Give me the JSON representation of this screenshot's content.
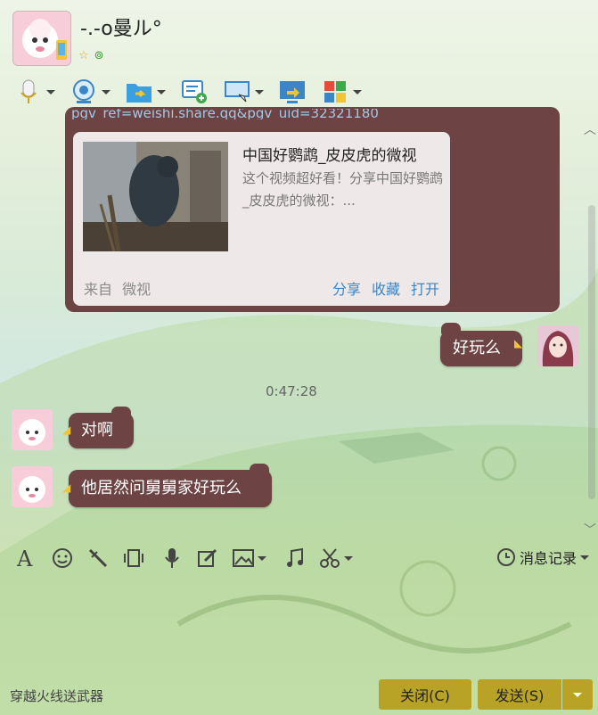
{
  "header": {
    "title": "-.-o曼ル°",
    "status_icons": [
      "star-icon",
      "search-icon"
    ]
  },
  "toolbar": {
    "buttons": [
      {
        "name": "voice-call",
        "icon": "microphone-icon",
        "has_dropdown": true
      },
      {
        "name": "video-call",
        "icon": "webcam-icon",
        "has_dropdown": true
      },
      {
        "name": "send-file",
        "icon": "folder-icon",
        "has_dropdown": true
      },
      {
        "name": "new-discussion",
        "icon": "chat-add-icon",
        "has_dropdown": false
      },
      {
        "name": "remote-desktop",
        "icon": "monitor-icon",
        "has_dropdown": true
      },
      {
        "name": "share-screen",
        "icon": "screen-share-icon",
        "has_dropdown": false
      },
      {
        "name": "apps",
        "icon": "apps-grid-icon",
        "has_dropdown": true
      }
    ]
  },
  "chat": {
    "share_link_fragment": "pgv_ref=weishi.share.qq&pgv_uid=32321180",
    "share_card": {
      "title": "中国好鹦鹉_皮皮虎的微视",
      "description": "这个视频超好看！分享中国好鹦鹉_皮皮虎的微视：...",
      "source_prefix": "来自",
      "source_name": "微视",
      "actions": [
        "分享",
        "收藏",
        "打开"
      ]
    },
    "messages": [
      {
        "side": "right",
        "text": "好玩么"
      },
      {
        "side": "left",
        "text": "对啊"
      },
      {
        "side": "left",
        "text": "他居然问舅舅家好玩么"
      }
    ],
    "timestamp": "0:47:28"
  },
  "input_toolbar": {
    "tools": [
      "font-icon",
      "emoji-icon",
      "magic-icon",
      "shake-icon",
      "voice-icon",
      "edit-icon",
      "image-icon",
      "music-icon",
      "scissors-icon"
    ],
    "history_label": "消息记录"
  },
  "footer": {
    "left_text": "穿越火线送武器",
    "close_label": "关闭(C)",
    "send_label": "发送(S)"
  },
  "colors": {
    "bubble": "#6e4343",
    "button": "#b9a326",
    "link": "#3a86c6"
  }
}
